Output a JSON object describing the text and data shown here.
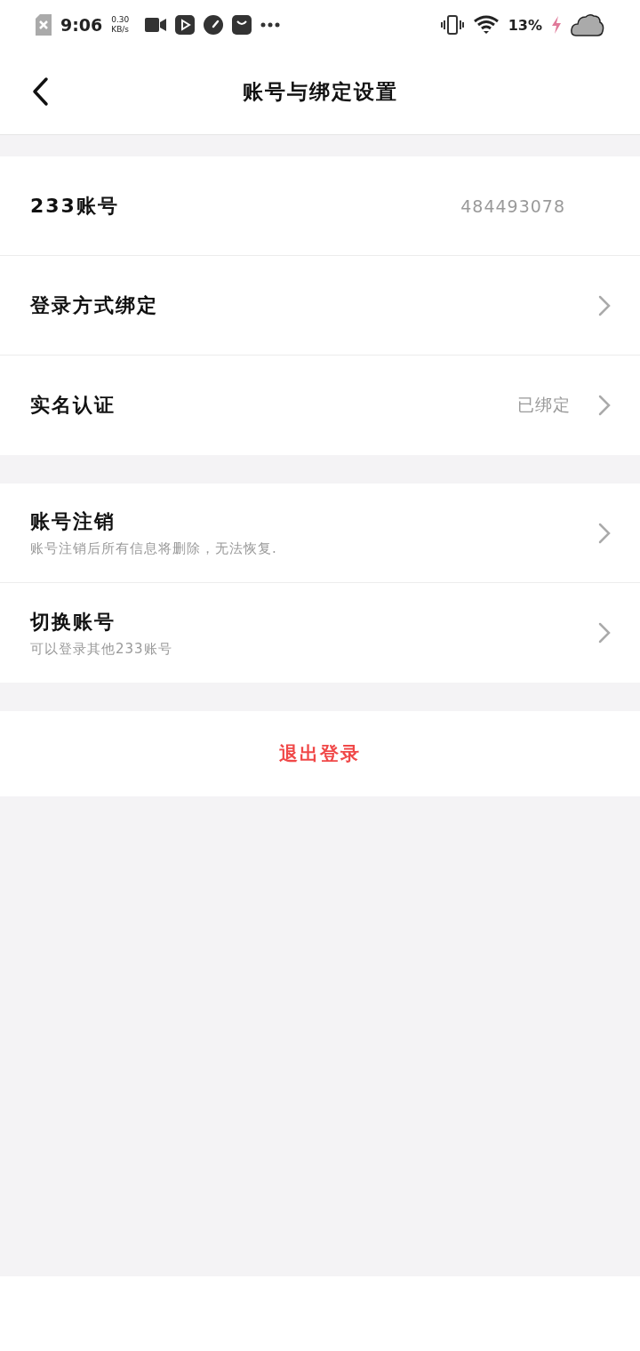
{
  "status_bar": {
    "time": "9:06",
    "speed": "0.30",
    "speed_unit": "KB/s",
    "battery": "13%",
    "charging": true
  },
  "header": {
    "title": "账号与绑定设置"
  },
  "groups": [
    {
      "rows": [
        {
          "label": "233账号",
          "value": "484493078",
          "arrow": false
        },
        {
          "label": "登录方式绑定",
          "arrow": true
        },
        {
          "label": "实名认证",
          "value": "已绑定",
          "arrow": true
        }
      ]
    },
    {
      "rows": [
        {
          "label": "账号注销",
          "subtitle": "账号注销后所有信息将删除，无法恢复.",
          "arrow": true
        },
        {
          "label": "切换账号",
          "subtitle": "可以登录其他233账号",
          "arrow": true
        }
      ]
    }
  ],
  "logout": {
    "label": "退出登录"
  }
}
